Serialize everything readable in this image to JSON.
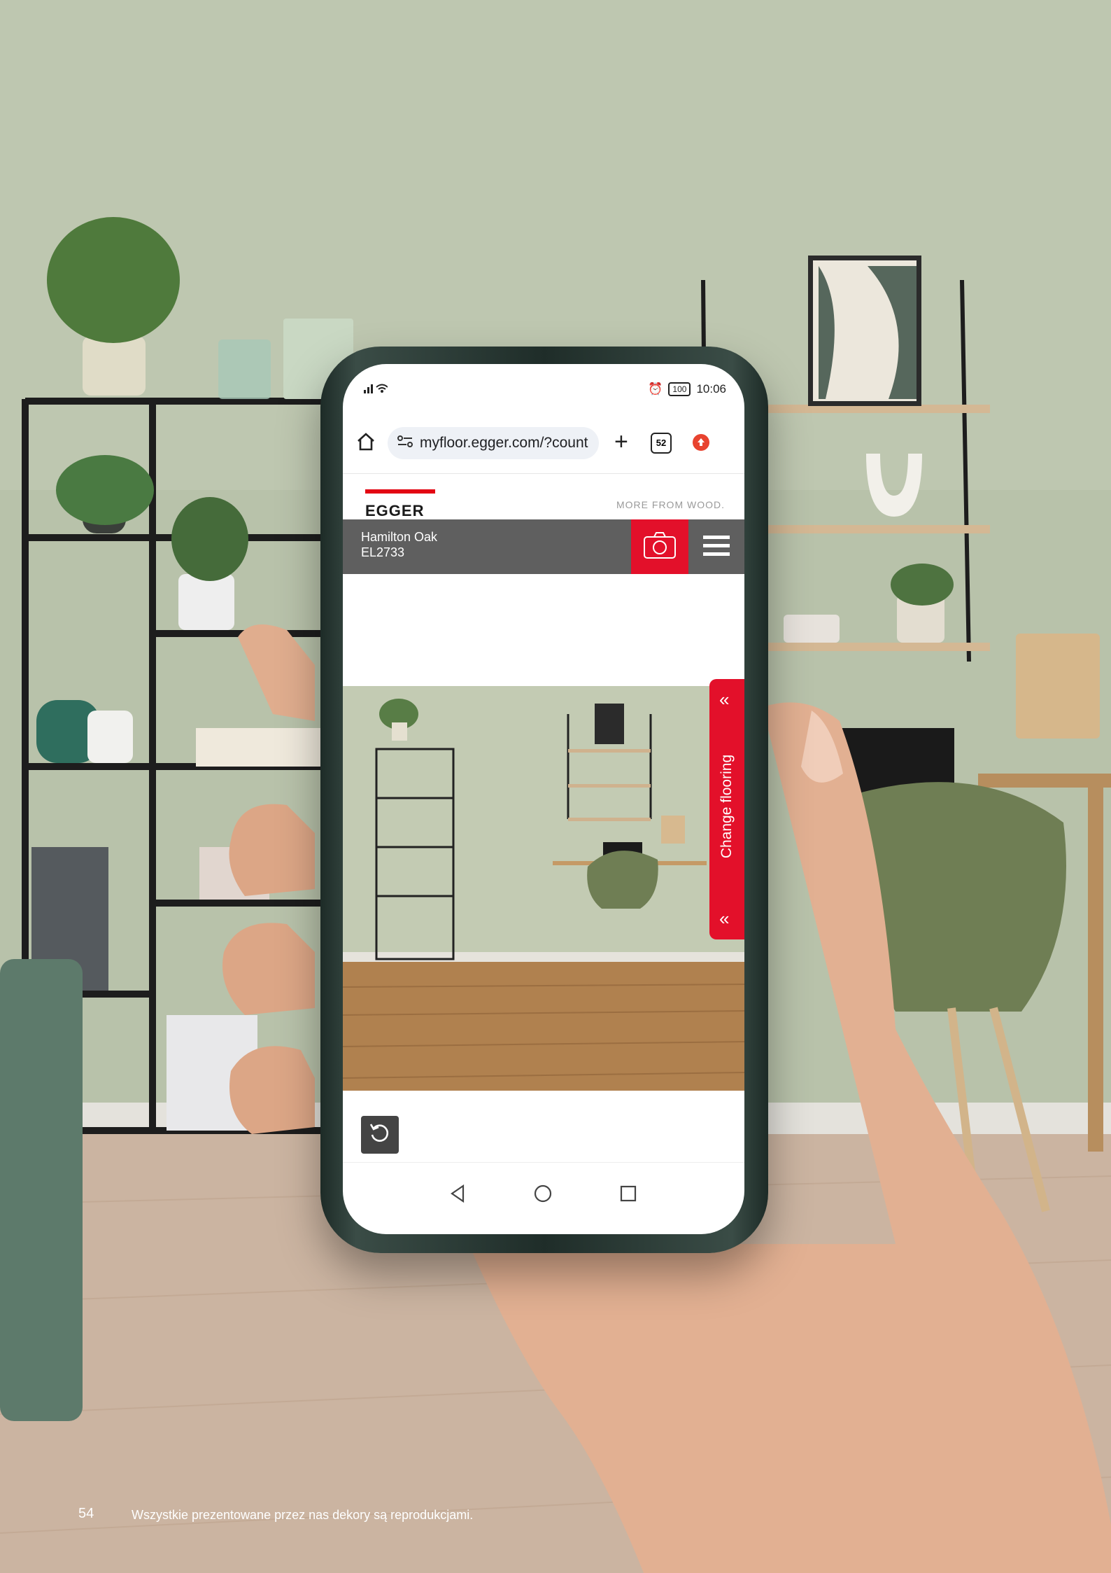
{
  "status_bar": {
    "signal": "all",
    "battery": "100",
    "time": "10:06"
  },
  "browser": {
    "url": "myfloor.egger.com/?count",
    "tabs_count": "52"
  },
  "site_header": {
    "logo": "EGGER",
    "tagline": "MORE FROM WOOD."
  },
  "product": {
    "name": "Hamilton Oak",
    "code": "EL2733"
  },
  "change_flooring_label": "Change flooring",
  "footer": {
    "page_number": "54",
    "disclaimer": "Wszystkie prezentowane przez nas dekory są reprodukcjami."
  },
  "colors": {
    "accent_red": "#e3102a",
    "product_bar_grey": "#5f5f5f",
    "wall_green": "#b8c2aa",
    "floor_tone": "#cbb4a1"
  }
}
